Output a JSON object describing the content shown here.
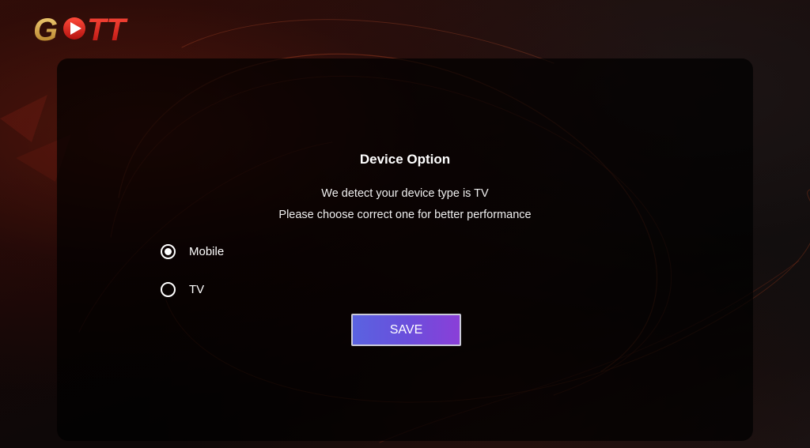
{
  "app": {
    "logo_text": "GOTT"
  },
  "dialog": {
    "title": "Device Option",
    "line_1": "We detect your device type is TV",
    "line_2": "Please choose correct one for better performance",
    "options": [
      {
        "label": "Mobile",
        "selected": true
      },
      {
        "label": "TV",
        "selected": false
      }
    ],
    "save_label": "SAVE"
  },
  "colors": {
    "accent_gradient_start": "#5a63e0",
    "accent_gradient_end": "#8a3fd8",
    "logo_gold": "#d9a441",
    "logo_red": "#e0201c"
  }
}
